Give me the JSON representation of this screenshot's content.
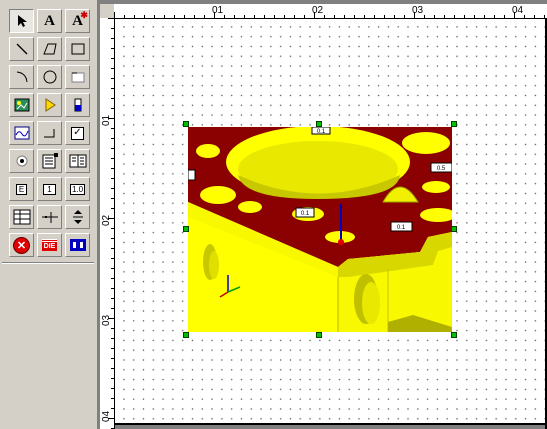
{
  "toolbox": {
    "tools": [
      {
        "name": "select-arrow-icon",
        "glyph": "↖"
      },
      {
        "name": "text-tool-icon",
        "glyph": "A"
      },
      {
        "name": "text-special-tool-icon",
        "glyph": "A"
      },
      {
        "name": "line-tool-icon",
        "glyph": ""
      },
      {
        "name": "polygon-tool-icon",
        "glyph": ""
      },
      {
        "name": "rectangle-tool-icon",
        "glyph": ""
      },
      {
        "name": "arc-tool-icon",
        "glyph": ""
      },
      {
        "name": "circle-tool-icon",
        "glyph": ""
      },
      {
        "name": "frame-tool-icon",
        "glyph": ""
      },
      {
        "name": "picture-tool-icon",
        "glyph": ""
      },
      {
        "name": "play-tool-icon",
        "glyph": ""
      },
      {
        "name": "bar-tool-icon",
        "glyph": ""
      },
      {
        "name": "graph-tool-icon",
        "glyph": ""
      },
      {
        "name": "step-tool-icon",
        "glyph": ""
      },
      {
        "name": "checkbox-tool-icon",
        "glyph": "✓"
      },
      {
        "name": "radio-tool-icon",
        "glyph": ""
      },
      {
        "name": "document-tool-icon",
        "glyph": ""
      },
      {
        "name": "table-tool-icon",
        "glyph": ""
      },
      {
        "name": "dimension-e-tool-icon",
        "glyph": "E"
      },
      {
        "name": "dimension-1-tool-icon",
        "glyph": "1"
      },
      {
        "name": "dimension-10-tool-icon",
        "glyph": "1.0"
      },
      {
        "name": "grid-tool-icon",
        "glyph": ""
      },
      {
        "name": "junction-tool-icon",
        "glyph": ""
      },
      {
        "name": "spin-tool-icon",
        "glyph": ""
      },
      {
        "name": "stop-tool-icon",
        "glyph": "✕"
      },
      {
        "name": "die-tool-icon",
        "glyph": "DIE"
      },
      {
        "name": "control-tool-icon",
        "glyph": ""
      }
    ]
  },
  "ruler": {
    "top_labels": [
      "01",
      "02",
      "03",
      "04"
    ],
    "left_labels": [
      "01",
      "02",
      "03",
      "04"
    ]
  },
  "labels": {
    "callout_top": "0.1",
    "callout_right": "0.5",
    "callout_center": "0.1",
    "callout_lower": "0.1"
  },
  "colors": {
    "part_yellow": "#ffff00",
    "part_dark_red": "#8b0000",
    "handle_green": "#00c000"
  }
}
